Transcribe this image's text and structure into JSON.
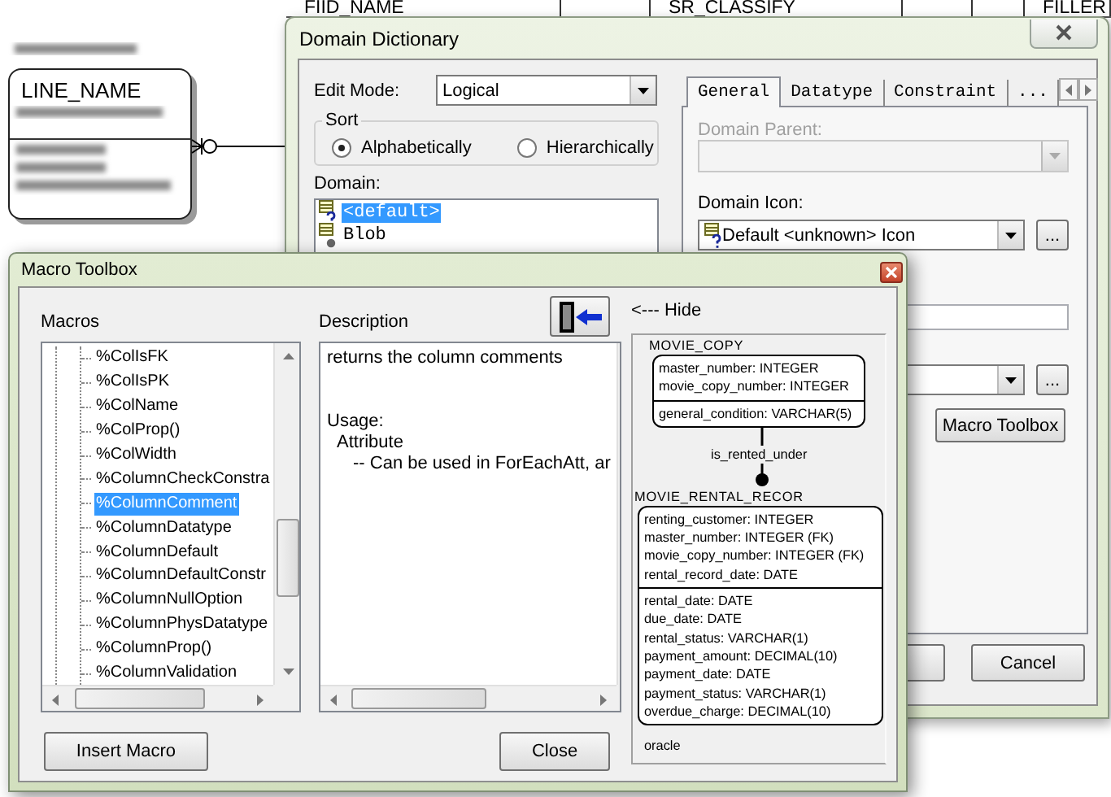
{
  "background_diagram": {
    "table_header": [
      "FIID_NAME",
      "SR_CLASSIFY",
      "FILLER"
    ],
    "entity": "LINE_NAME"
  },
  "domain_dictionary": {
    "title": "Domain Dictionary",
    "edit_mode": {
      "label": "Edit Mode:",
      "value": "Logical"
    },
    "sort": {
      "label": "Sort",
      "options": [
        {
          "label": "Alphabetically",
          "selected": true
        },
        {
          "label": "Hierarchically",
          "selected": false
        }
      ]
    },
    "domain": {
      "label": "Domain:",
      "items": [
        {
          "label": "<default>",
          "kind": "unknown",
          "selected": true
        },
        {
          "label": "Blob",
          "kind": "dot",
          "selected": false
        }
      ]
    },
    "tabs": [
      {
        "label": "General",
        "selected": true
      },
      {
        "label": "Datatype",
        "selected": false
      },
      {
        "label": "Constraint",
        "selected": false
      },
      {
        "label": "...",
        "selected": false
      }
    ],
    "domain_parent": {
      "label": "Domain Parent:",
      "disabled": true
    },
    "domain_icon": {
      "label": "Domain Icon:",
      "value": "Default <unknown> Icon",
      "browse": "..."
    },
    "lower_browse": "...",
    "macro_toolbox_button": "Macro Toolbox",
    "cancel_button": "Cancel"
  },
  "macro_toolbox": {
    "title": "Macro Toolbox",
    "macros_label": "Macros",
    "description_label": "Description",
    "hide_label": "<--- Hide",
    "macros": [
      {
        "label": "%ColIsFK",
        "selected": false
      },
      {
        "label": "%ColIsPK",
        "selected": false
      },
      {
        "label": "%ColName",
        "selected": false
      },
      {
        "label": "%ColProp()",
        "selected": false
      },
      {
        "label": "%ColWidth",
        "selected": false
      },
      {
        "label": "%ColumnCheckConstra",
        "selected": false
      },
      {
        "label": "%ColumnComment",
        "selected": true
      },
      {
        "label": "%ColumnDatatype",
        "selected": false
      },
      {
        "label": "%ColumnDefault",
        "selected": false
      },
      {
        "label": "%ColumnDefaultConstr",
        "selected": false
      },
      {
        "label": "%ColumnNullOption",
        "selected": false
      },
      {
        "label": "%ColumnPhysDatatype",
        "selected": false
      },
      {
        "label": "%ColumnProp()",
        "selected": false
      },
      {
        "label": "%ColumnValidation",
        "selected": false
      }
    ],
    "description": {
      "summary": "returns the column comments",
      "usage_heading": "Usage:",
      "usage": [
        {
          "term": "Attribute",
          "notes": [
            "-- Can be used in ForEachAtt, ar"
          ]
        }
      ]
    },
    "diagram": {
      "entities": [
        {
          "name": "MOVIE_COPY",
          "keys": [
            "master_number: INTEGER",
            "movie_copy_number: INTEGER"
          ],
          "attributes": [
            "general_condition: VARCHAR(5)"
          ]
        },
        {
          "name": "MOVIE_RENTAL_RECOR",
          "keys": [
            "renting_customer: INTEGER",
            "master_number: INTEGER (FK)",
            "movie_copy_number: INTEGER (FK)",
            "rental_record_date: DATE"
          ],
          "attributes": [
            "rental_date: DATE",
            "due_date: DATE",
            "rental_status: VARCHAR(1)",
            "payment_amount: DECIMAL(10)",
            "payment_date: DATE",
            "payment_status: VARCHAR(1)",
            "overdue_charge: DECIMAL(10)"
          ]
        }
      ],
      "relationship": "is_rented_under",
      "database": "oracle"
    },
    "insert_button": "Insert Macro",
    "close_button": "Close"
  }
}
